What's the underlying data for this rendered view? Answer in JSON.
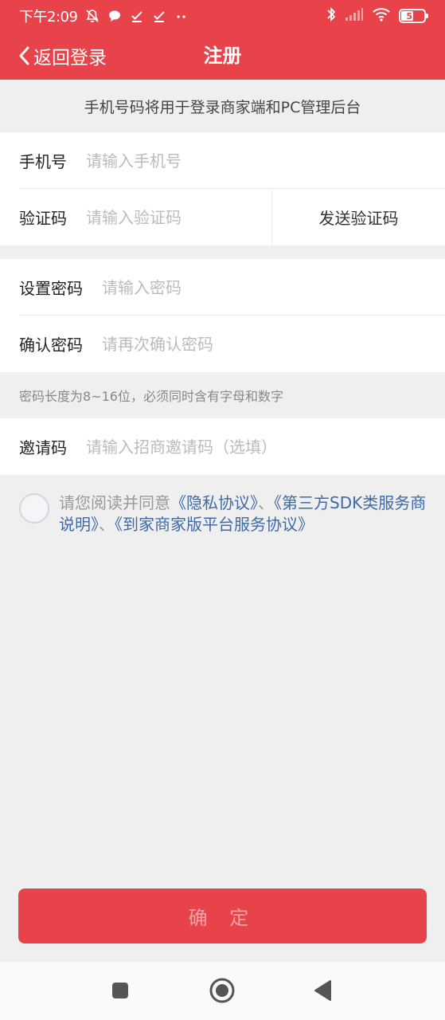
{
  "status_bar": {
    "time": "下午2:09",
    "battery": "53",
    "battery_level": 0.53,
    "icons_left": [
      "mute-bell-icon",
      "chat-bubble-icon",
      "check-icon",
      "check-icon",
      "more-dots-icon"
    ],
    "icons_right": [
      "bluetooth-icon",
      "signal-icon",
      "wifi-icon",
      "battery-icon"
    ]
  },
  "nav": {
    "back_label": "返回登录",
    "title": "注册"
  },
  "notice": "手机号码将用于登录商家端和PC管理后台",
  "form": {
    "phone": {
      "label": "手机号",
      "placeholder": "请输入手机号",
      "value": ""
    },
    "code": {
      "label": "验证码",
      "placeholder": "请输入验证码",
      "value": "",
      "send_label": "发送验证码"
    },
    "password": {
      "label": "设置密码",
      "placeholder": "请输入密码",
      "value": ""
    },
    "confirm_password": {
      "label": "确认密码",
      "placeholder": "请再次确认密码",
      "value": ""
    },
    "password_hint": "密码长度为8~16位，必须同时含有字母和数字",
    "invite": {
      "label": "邀请码",
      "placeholder": "请输入招商邀请码（选填）",
      "value": ""
    }
  },
  "agreement": {
    "checked": false,
    "prefix": "请您阅读并同意",
    "privacy": "《隐私协议》",
    "sep1": "、",
    "sdk": "《第三方SDK类服务商说明》",
    "sep2": "、",
    "service": "《到家商家版平台服务协议》"
  },
  "confirm_label": "确 定",
  "colors": {
    "primary": "#e8434a",
    "link": "#3e6aa8",
    "background": "#efefef"
  },
  "system_nav": [
    "square-recents-icon",
    "circle-home-icon",
    "triangle-back-icon"
  ]
}
